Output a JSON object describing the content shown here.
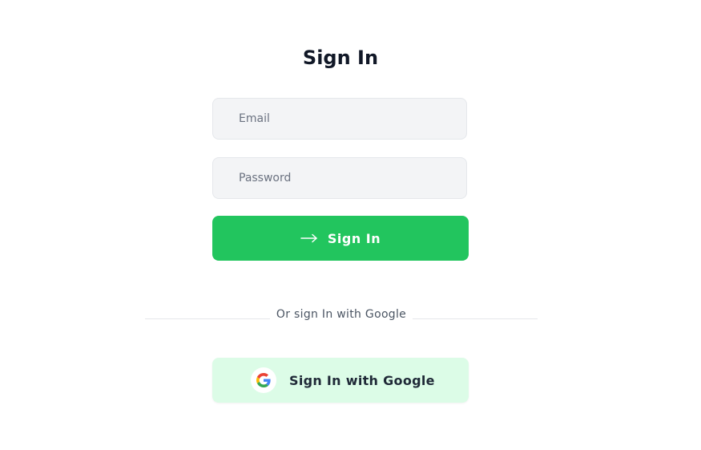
{
  "page": {
    "title": "Sign In"
  },
  "form": {
    "email": {
      "value": "",
      "placeholder": "Email"
    },
    "password": {
      "value": "",
      "placeholder": "Password"
    },
    "submit_label": "Sign In"
  },
  "divider": {
    "text": "Or sign In with Google"
  },
  "google": {
    "button_label": "Sign In with Google",
    "icon": "google-g-icon"
  },
  "colors": {
    "primary": "#22c55e",
    "google_button_bg": "#dcfce7",
    "input_bg": "#f3f4f6",
    "title": "#111827"
  },
  "icons": {
    "submit": "arrow-right-icon"
  }
}
